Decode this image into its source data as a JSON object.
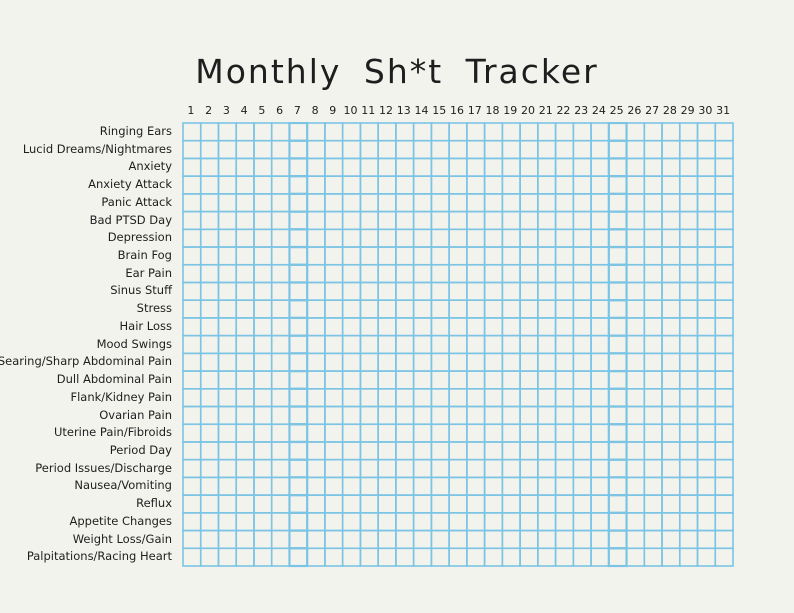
{
  "title": "Monthly Sh*t Tracker",
  "days": [
    "1",
    "2",
    "3",
    "4",
    "5",
    "6",
    "7",
    "8",
    "9",
    "10",
    "11",
    "12",
    "13",
    "14",
    "15",
    "16",
    "17",
    "18",
    "19",
    "20",
    "21",
    "22",
    "23",
    "24",
    "25",
    "26",
    "27",
    "28",
    "29",
    "30",
    "31"
  ],
  "rows": [
    "Ringing Ears",
    "Lucid Dreams/Nightmares",
    "Anxiety",
    "Anxiety Attack",
    "Panic Attack",
    "Bad PTSD Day",
    "Depression",
    "Brain Fog",
    "Ear Pain",
    "Sinus Stuff",
    "Stress",
    "Hair Loss",
    "Mood Swings",
    "Searing/Sharp Abdominal Pain",
    "Dull Abdominal Pain",
    "Flank/Kidney Pain",
    "Ovarian Pain",
    "Uterine Pain/Fibroids",
    "Period Day",
    "Period Issues/Discharge",
    "Nausea/Vomiting",
    "Reflux",
    "Appetite Changes",
    "Weight Loss/Gain",
    "Palpitations/Racing Heart"
  ],
  "colors": {
    "grid": "#7cc4e4",
    "background": "#f3f3ee",
    "text": "#1e1e1e"
  }
}
